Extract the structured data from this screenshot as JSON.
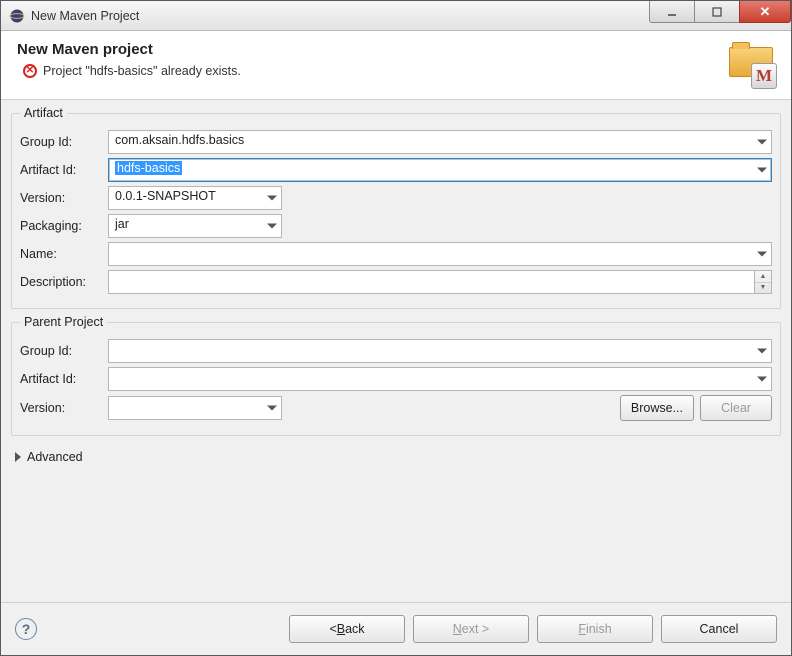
{
  "window": {
    "title": "New Maven Project"
  },
  "banner": {
    "heading": "New Maven project",
    "error": "Project \"hdfs-basics\" already exists.",
    "badge": "M"
  },
  "artifact": {
    "legend": "Artifact",
    "labels": {
      "groupId": "Group Id:",
      "artifactId": "Artifact Id:",
      "version": "Version:",
      "packaging": "Packaging:",
      "name": "Name:",
      "description": "Description:"
    },
    "values": {
      "groupId": "com.aksain.hdfs.basics",
      "artifactId": "hdfs-basics",
      "version": "0.0.1-SNAPSHOT",
      "packaging": "jar",
      "name": "",
      "description": ""
    }
  },
  "parent": {
    "legend": "Parent Project",
    "labels": {
      "groupId": "Group Id:",
      "artifactId": "Artifact Id:",
      "version": "Version:"
    },
    "values": {
      "groupId": "",
      "artifactId": "",
      "version": ""
    },
    "buttons": {
      "browse": "Browse...",
      "clear": "Clear"
    }
  },
  "advanced": {
    "label": "Advanced"
  },
  "footer": {
    "back": "Back",
    "next": "Next",
    "finish": "Finish",
    "cancel": "Cancel"
  }
}
